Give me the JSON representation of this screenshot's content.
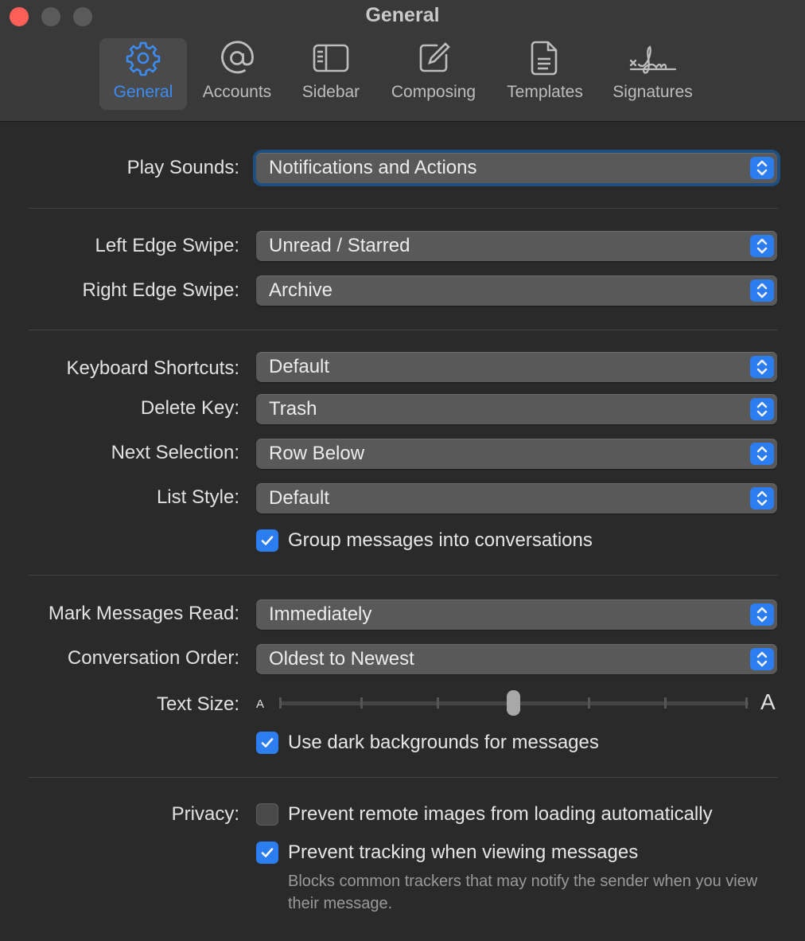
{
  "window": {
    "title": "General"
  },
  "tabs": [
    {
      "label": "General",
      "icon": "gear-icon",
      "active": true
    },
    {
      "label": "Accounts",
      "icon": "at-sign-icon"
    },
    {
      "label": "Sidebar",
      "icon": "sidebar-icon"
    },
    {
      "label": "Composing",
      "icon": "compose-icon"
    },
    {
      "label": "Templates",
      "icon": "document-icon"
    },
    {
      "label": "Signatures",
      "icon": "signature-icon"
    }
  ],
  "settings": {
    "play_sounds": {
      "label": "Play Sounds:",
      "value": "Notifications and Actions"
    },
    "left_edge_swipe": {
      "label": "Left Edge Swipe:",
      "value": "Unread / Starred"
    },
    "right_edge_swipe": {
      "label": "Right Edge Swipe:",
      "value": "Archive"
    },
    "keyboard_shortcuts": {
      "label": "Keyboard Shortcuts:",
      "value": "Default"
    },
    "delete_key": {
      "label": "Delete Key:",
      "value": "Trash"
    },
    "next_selection": {
      "label": "Next Selection:",
      "value": "Row Below"
    },
    "list_style": {
      "label": "List Style:",
      "value": "Default"
    },
    "group_messages": {
      "label": "Group messages into conversations",
      "checked": true
    },
    "mark_read": {
      "label": "Mark Messages Read:",
      "value": "Immediately"
    },
    "conversation_order": {
      "label": "Conversation Order:",
      "value": "Oldest to Newest"
    },
    "text_size": {
      "label": "Text Size:",
      "small": "A",
      "large": "A",
      "steps": 7,
      "position": 3
    },
    "dark_backgrounds": {
      "label": "Use dark backgrounds for messages",
      "checked": true
    },
    "privacy": {
      "label": "Privacy:",
      "remote_images": {
        "label": "Prevent remote images from loading automatically",
        "checked": false
      },
      "tracking": {
        "label": "Prevent tracking when viewing messages",
        "checked": true
      },
      "tracking_note": "Blocks common trackers that may notify the sender when you view their message."
    }
  },
  "colors": {
    "accent": "#2c7ef0",
    "background": "#2a2a2a",
    "close": "#fe5f57"
  }
}
